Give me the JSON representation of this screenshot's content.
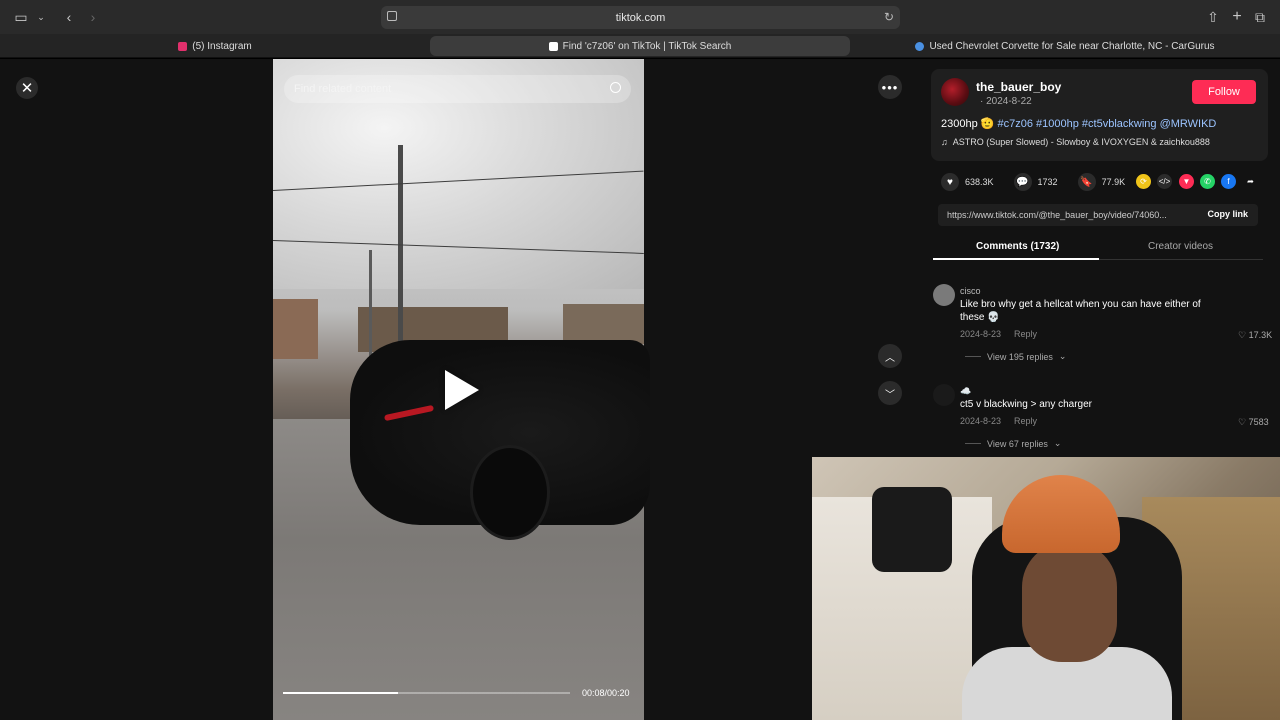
{
  "browser": {
    "url": "tiktok.com",
    "tabs": [
      {
        "label": "(5) Instagram",
        "color": "#e1306c"
      },
      {
        "label": "Find 'c7z06' on TikTok | TikTok Search",
        "color": "#ffffff"
      },
      {
        "label": "Used Chevrolet Corvette for Sale near Charlotte, NC - CarGurus",
        "color": "#4a90e2"
      }
    ]
  },
  "video": {
    "search_placeholder": "Find related content",
    "time": "00:08/00:20",
    "progress": 0.4
  },
  "post": {
    "username": "the_bauer_boy",
    "date": "· 2024-8-22",
    "follow_label": "Follow",
    "caption_prefix": "2300hp 🫡 ",
    "hashtags": "#c7z06 #1000hp #ct5vblackwing @MRWIKD",
    "music": "ASTRO (Super Slowed) - Slowboy & IVOXYGEN & zaichkou888",
    "likes": "638.3K",
    "comments": "1732",
    "saves": "77.9K",
    "link": "https://www.tiktok.com/@the_bauer_boy/video/74060...",
    "copy_link": "Copy link"
  },
  "panel_tabs": {
    "comments": "Comments (1732)",
    "creator": "Creator videos"
  },
  "comments": [
    {
      "name": "cisco",
      "text": "Like bro why get a hellcat when you can have either of these 💀",
      "date": "2024-8-23",
      "reply": "Reply",
      "likes": "17.3K",
      "replies": "View 195 replies"
    },
    {
      "name": "☁️",
      "text": "ct5 v blackwing > any charger",
      "date": "2024-8-23",
      "reply": "Reply",
      "likes": "7583",
      "replies": "View 67 replies"
    }
  ],
  "icons": {
    "close": "close-icon",
    "more": "more-icon",
    "up": "chevron-up-icon",
    "down": "chevron-down-icon"
  }
}
